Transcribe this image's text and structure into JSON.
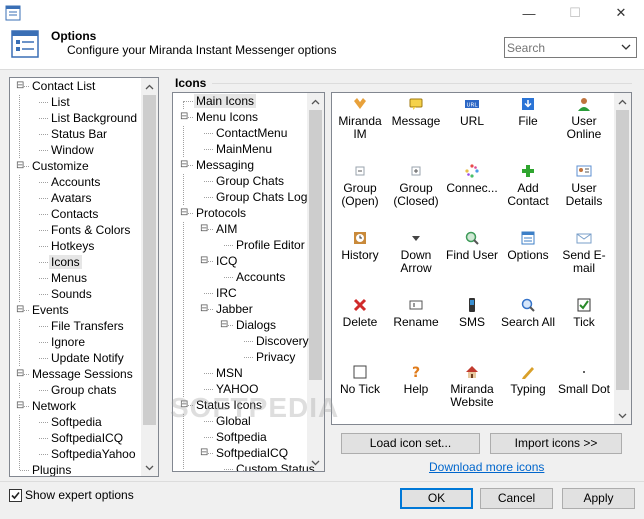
{
  "window": {
    "title_icon": "options-icon",
    "minimize": "—",
    "maximize": "☐",
    "close": "✕"
  },
  "header": {
    "title": "Options",
    "subtitle": "Configure your Miranda Instant Messenger options",
    "search_placeholder": "Search"
  },
  "left_tree": [
    {
      "label": "Contact List",
      "level": 0,
      "toggle": "⊟"
    },
    {
      "label": "List",
      "level": 1
    },
    {
      "label": "List Background",
      "level": 1
    },
    {
      "label": "Status Bar",
      "level": 1
    },
    {
      "label": "Window",
      "level": 1
    },
    {
      "label": "Customize",
      "level": 0,
      "toggle": "⊟"
    },
    {
      "label": "Accounts",
      "level": 1
    },
    {
      "label": "Avatars",
      "level": 1
    },
    {
      "label": "Contacts",
      "level": 1
    },
    {
      "label": "Fonts & Colors",
      "level": 1
    },
    {
      "label": "Hotkeys",
      "level": 1
    },
    {
      "label": "Icons",
      "level": 1,
      "selected": true
    },
    {
      "label": "Menus",
      "level": 1
    },
    {
      "label": "Sounds",
      "level": 1
    },
    {
      "label": "Events",
      "level": 0,
      "toggle": "⊟"
    },
    {
      "label": "File Transfers",
      "level": 1
    },
    {
      "label": "Ignore",
      "level": 1
    },
    {
      "label": "Update Notify",
      "level": 1
    },
    {
      "label": "Message Sessions",
      "level": 0,
      "toggle": "⊟"
    },
    {
      "label": "Group chats",
      "level": 1
    },
    {
      "label": "Network",
      "level": 0,
      "toggle": "⊟"
    },
    {
      "label": "Softpedia",
      "level": 1
    },
    {
      "label": "SoftpediaICQ",
      "level": 1
    },
    {
      "label": "SoftpediaYahoo",
      "level": 1
    },
    {
      "label": "Plugins",
      "level": 0
    }
  ],
  "icons_section_label": "Icons",
  "mid_tree": [
    {
      "label": "Main Icons",
      "level": 0,
      "selected": true
    },
    {
      "label": "Menu Icons",
      "level": 0,
      "toggle": "⊟"
    },
    {
      "label": "ContactMenu",
      "level": 1
    },
    {
      "label": "MainMenu",
      "level": 1
    },
    {
      "label": "Messaging",
      "level": 0,
      "toggle": "⊟"
    },
    {
      "label": "Group Chats",
      "level": 1
    },
    {
      "label": "Group Chats Log",
      "level": 1
    },
    {
      "label": "Protocols",
      "level": 0,
      "toggle": "⊟"
    },
    {
      "label": "AIM",
      "level": 1,
      "toggle": "⊟"
    },
    {
      "label": "Profile Editor",
      "level": 2
    },
    {
      "label": "ICQ",
      "level": 1,
      "toggle": "⊟"
    },
    {
      "label": "Accounts",
      "level": 2
    },
    {
      "label": "IRC",
      "level": 1
    },
    {
      "label": "Jabber",
      "level": 1,
      "toggle": "⊟"
    },
    {
      "label": "Dialogs",
      "level": 2,
      "toggle": "⊟"
    },
    {
      "label": "Discovery",
      "level": 3
    },
    {
      "label": "Privacy",
      "level": 3
    },
    {
      "label": "MSN",
      "level": 1
    },
    {
      "label": "YAHOO",
      "level": 1
    },
    {
      "label": "Status Icons",
      "level": 0,
      "toggle": "⊟"
    },
    {
      "label": "Global",
      "level": 1
    },
    {
      "label": "Softpedia",
      "level": 1
    },
    {
      "label": "SoftpediaICQ",
      "level": 1,
      "toggle": "⊟"
    },
    {
      "label": "Custom Status",
      "level": 2
    }
  ],
  "icon_grid": [
    {
      "label": "Miranda IM",
      "icon": "miranda-icon",
      "color": "#e8a13a"
    },
    {
      "label": "Message",
      "icon": "message-icon",
      "color": "#f5d24a"
    },
    {
      "label": "URL",
      "icon": "url-icon",
      "color": "#2b66c5"
    },
    {
      "label": "File",
      "icon": "file-icon",
      "color": "#2b74d6"
    },
    {
      "label": "User Online",
      "icon": "user-online-icon",
      "color": "#c0733d"
    },
    {
      "label": "Group (Open)",
      "icon": "group-open-icon",
      "color": "#9aa3ad"
    },
    {
      "label": "Group (Closed)",
      "icon": "group-closed-icon",
      "color": "#9aa3ad"
    },
    {
      "label": "Connec...",
      "icon": "connecting-icon",
      "color": "#d94c9a"
    },
    {
      "label": "Add Contact",
      "icon": "add-contact-icon",
      "color": "#2fa52f"
    },
    {
      "label": "User Details",
      "icon": "user-details-icon",
      "color": "#5c8fd1"
    },
    {
      "label": "History",
      "icon": "history-icon",
      "color": "#c98a3b"
    },
    {
      "label": "Down Arrow",
      "icon": "down-arrow-icon",
      "color": "#444444"
    },
    {
      "label": "Find User",
      "icon": "find-user-icon",
      "color": "#3f9b5a"
    },
    {
      "label": "Options",
      "icon": "options-icon",
      "color": "#3c7fc7"
    },
    {
      "label": "Send E-mail",
      "icon": "send-email-icon",
      "color": "#7a9fc9"
    },
    {
      "label": "Delete",
      "icon": "delete-icon",
      "color": "#d02a2a"
    },
    {
      "label": "Rename",
      "icon": "rename-icon",
      "color": "#555555"
    },
    {
      "label": "SMS",
      "icon": "sms-icon",
      "color": "#3a8fd1"
    },
    {
      "label": "Search All",
      "icon": "search-all-icon",
      "color": "#3573c9"
    },
    {
      "label": "Tick",
      "icon": "tick-icon",
      "color": "#2a8a2a"
    },
    {
      "label": "No Tick",
      "icon": "no-tick-icon",
      "color": "#444444"
    },
    {
      "label": "Help",
      "icon": "help-icon",
      "color": "#e07b1a"
    },
    {
      "label": "Miranda Website",
      "icon": "website-icon",
      "color": "#c23b2e"
    },
    {
      "label": "Typing",
      "icon": "typing-icon",
      "color": "#d9a02a"
    },
    {
      "label": "Small Dot",
      "icon": "small-dot-icon",
      "color": "#333333"
    }
  ],
  "buttons": {
    "load_icon_set": "Load icon set...",
    "import_icons": "Import icons >>",
    "download_more": "Download more icons",
    "ok": "OK",
    "cancel": "Cancel",
    "apply": "Apply"
  },
  "show_expert": {
    "label": "Show expert options",
    "checked": true
  },
  "watermark": "SOFTPEDIA"
}
